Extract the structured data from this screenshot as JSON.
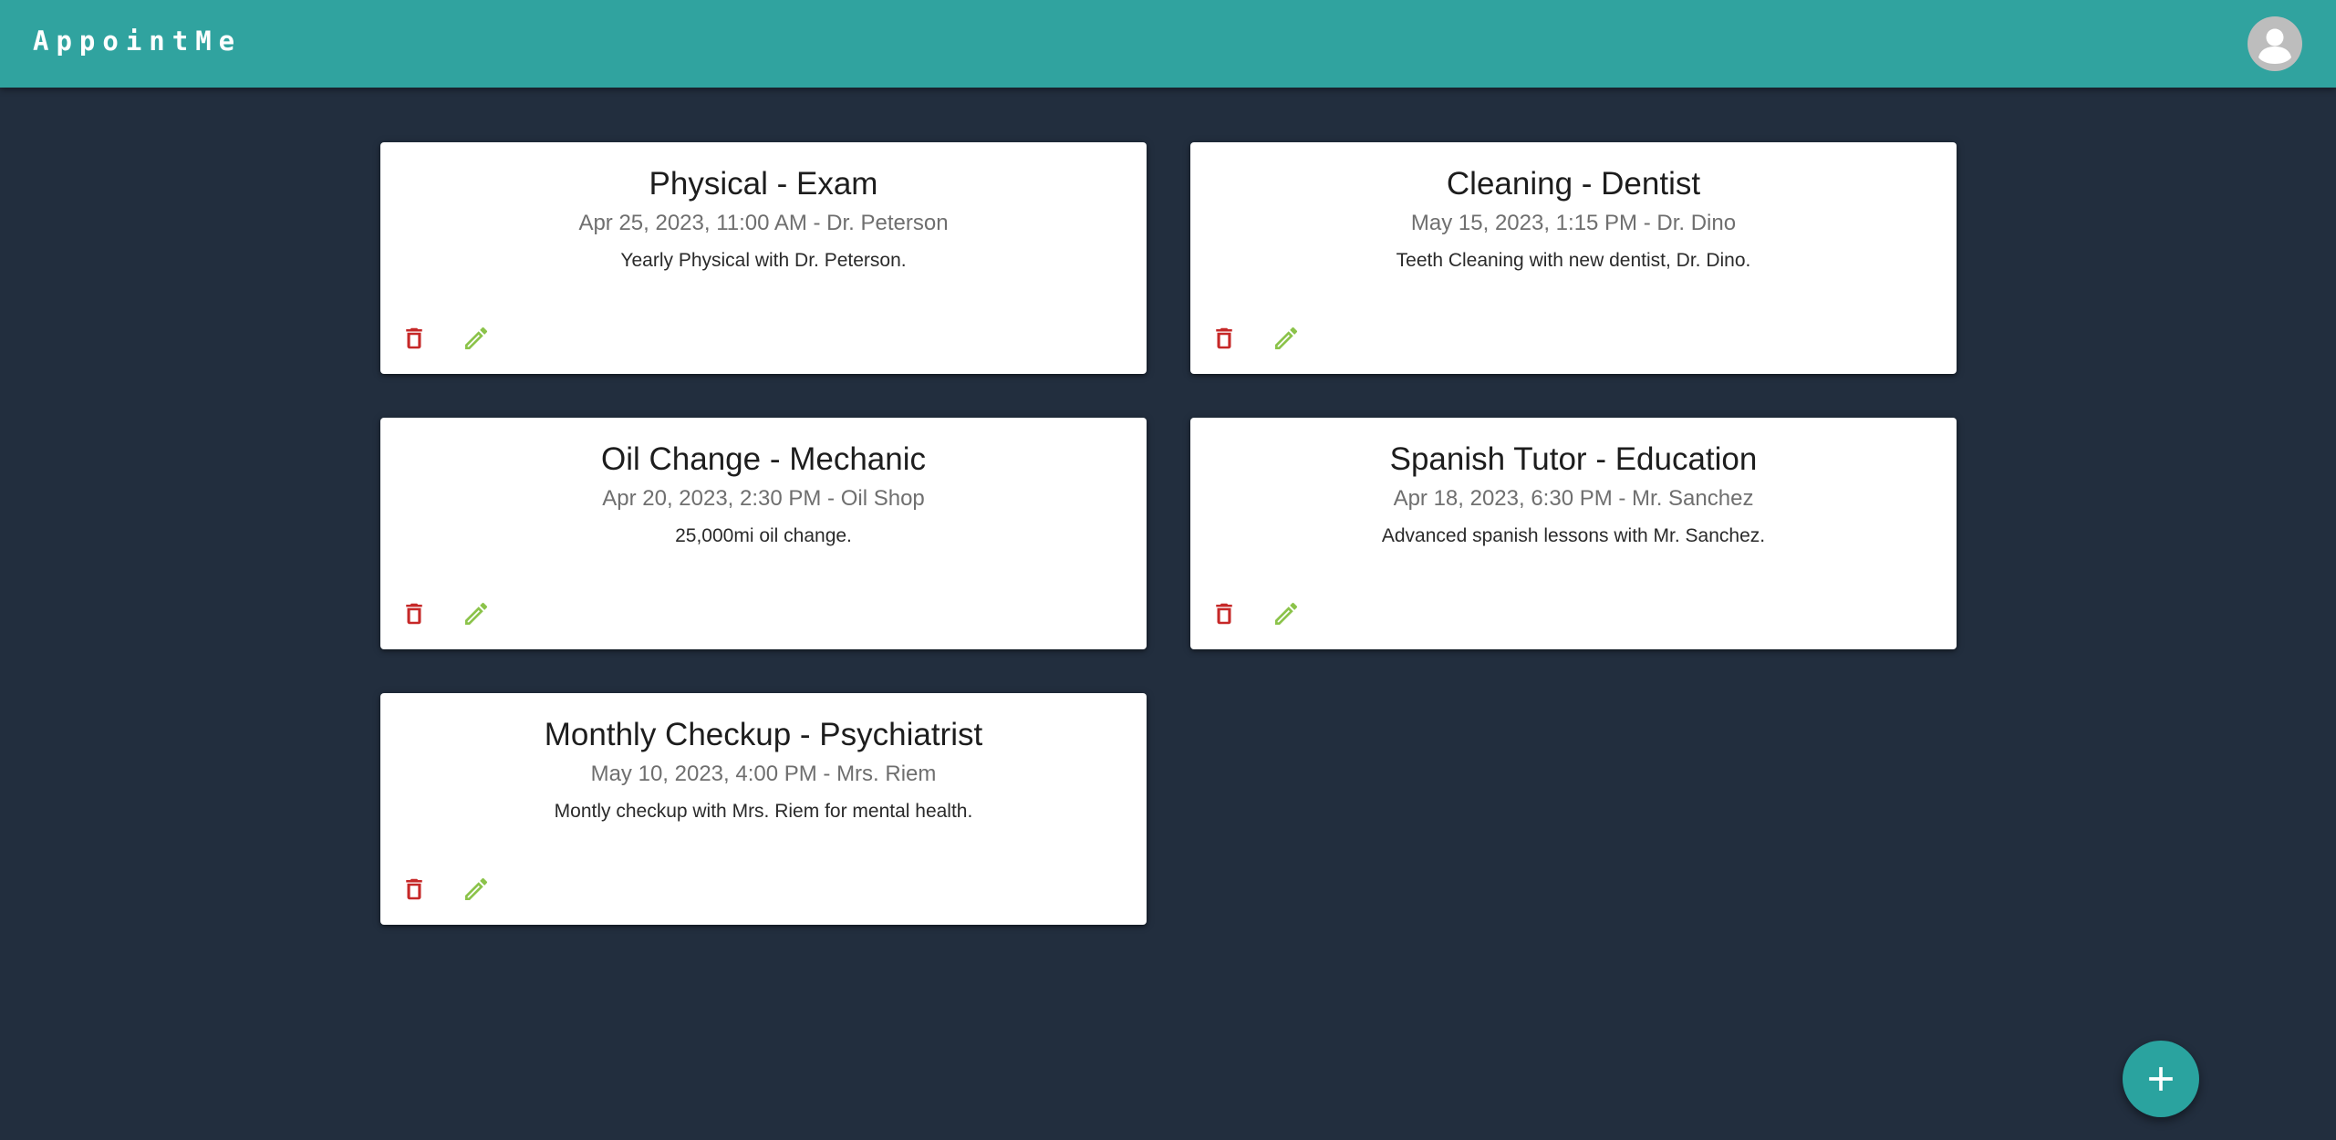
{
  "app": {
    "title": "AppointMe"
  },
  "colors": {
    "appbar": "#30a39f",
    "background": "#222e3e",
    "delete_icon": "#c62828",
    "edit_icon": "#8bc34a",
    "fab": "#2aa39f"
  },
  "icons": {
    "account": "account-circle-icon",
    "delete": "trash-icon",
    "edit": "pencil-icon",
    "add": "plus-icon"
  },
  "appointments": [
    {
      "title": "Physical - Exam",
      "subtitle": "Apr 25, 2023, 11:00 AM - Dr. Peterson",
      "description": "Yearly Physical with Dr. Peterson."
    },
    {
      "title": "Cleaning - Dentist",
      "subtitle": "May 15, 2023, 1:15 PM - Dr. Dino",
      "description": "Teeth Cleaning with new dentist, Dr. Dino."
    },
    {
      "title": "Oil Change - Mechanic",
      "subtitle": "Apr 20, 2023, 2:30 PM - Oil Shop",
      "description": "25,000mi oil change."
    },
    {
      "title": "Spanish Tutor - Education",
      "subtitle": "Apr 18, 2023, 6:30 PM - Mr. Sanchez",
      "description": "Advanced spanish lessons with Mr. Sanchez."
    },
    {
      "title": "Monthly Checkup - Psychiatrist",
      "subtitle": "May 10, 2023, 4:00 PM - Mrs. Riem",
      "description": "Montly checkup with Mrs. Riem for mental health."
    }
  ]
}
